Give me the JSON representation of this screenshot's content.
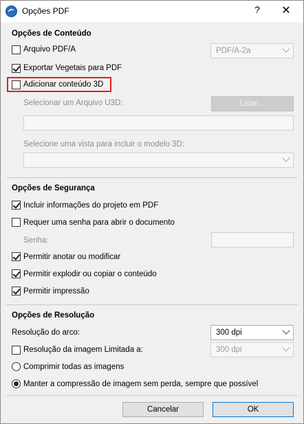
{
  "window": {
    "title": "Opções PDF",
    "help": "?",
    "close": "✕"
  },
  "content": {
    "section_title": "Opções de Conteúdo",
    "pdfa_label": "Arquivo PDF/A",
    "pdfa_checked": false,
    "pdfa_select": "PDF/A-2a",
    "vectors_label": "Exportar Vegetais para PDF",
    "vectors_checked": true,
    "add3d_label": "Adicionar conteúdo 3D",
    "add3d_checked": false,
    "u3d_label": "Selecionar um Arquivo U3D:",
    "list_button": "Listar...",
    "u3d_path": "",
    "view_label": "Selecione uma vista para incluir o modelo 3D:",
    "view_select": ""
  },
  "security": {
    "section_title": "Opções de Segurança",
    "project_info_label": "Incluir informações do projeto em PDF",
    "project_info_checked": true,
    "password_required_label": "Requer uma senha para abrir o documento",
    "password_required_checked": false,
    "password_label": "Senha:",
    "password_value": "",
    "annotate_label": "Permitir anotar ou modificar",
    "annotate_checked": true,
    "explode_label": "Permitir explodir ou copiar o conteúdo",
    "explode_checked": true,
    "print_label": "Permitir impressão",
    "print_checked": true
  },
  "resolution": {
    "section_title": "Opções de Resolução",
    "arc_label": "Resolução do arco:",
    "arc_value": "300 dpi",
    "limit_label": "Resolução da imagem Limitada a:",
    "limit_checked": false,
    "limit_value": "300 dpi",
    "compress_all_label": "Comprimir todas as imagens",
    "compress_all_selected": false,
    "lossless_label": "Manter a compressão de imagem sem perda, sempre que possível",
    "lossless_selected": true
  },
  "footer": {
    "cancel": "Cancelar",
    "ok": "OK"
  },
  "colors": {
    "highlight": "#e02020",
    "accent": "#0078d7"
  }
}
